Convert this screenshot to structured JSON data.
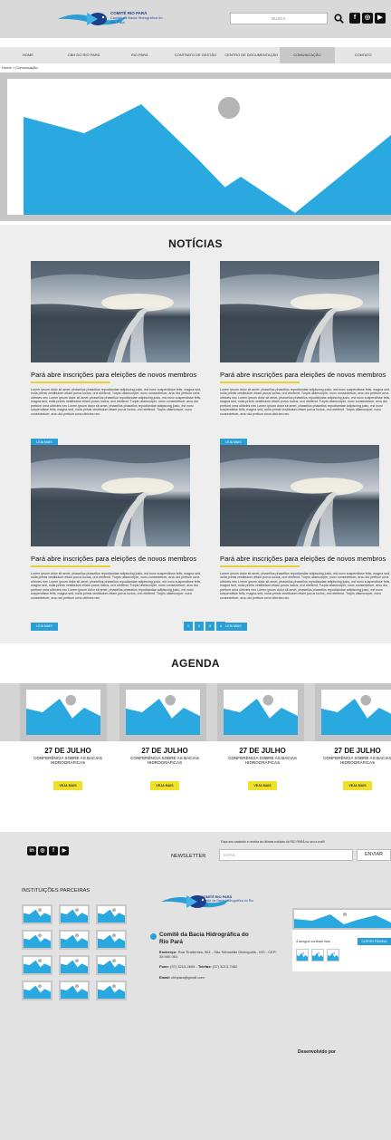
{
  "header": {
    "logo_title": "COMITÊ RIO PARÁ",
    "logo_subtitle": "Comitê da Bacia Hidrográfica do Rio Pará",
    "search_placeholder": "BUSCA"
  },
  "social_icons": [
    "linkedin-icon",
    "instagram-icon",
    "facebook-icon",
    "youtube-icon"
  ],
  "nav": {
    "items": [
      {
        "label": "HOME"
      },
      {
        "label": "CBH DO RIO PARÁ"
      },
      {
        "label": "RIO PARÁ"
      },
      {
        "label": "CONTRATO DE GESTÃO"
      },
      {
        "label": "CENTRO DE DOCUMENTAÇÃO"
      },
      {
        "label": "COMUNICAÇÃO"
      },
      {
        "label": "CONTATO"
      }
    ],
    "active_index": 5
  },
  "breadcrumb": "Home > Comunicação",
  "noticias": {
    "title": "NOTÍCIAS",
    "cards": [
      {
        "title": "Pará abre inscrições para eleições de novos membros",
        "body": "Lorem ipsum dolor sit amet, phasellus phasellus repudiandae adipiscing justo, est nunc suspendisse felis, magna sed, nulla primis vestibulum etiam purus luctus, orci eleifend. Turpis ullamcorper, nunc consectetuer, arcu dui pretium urna ultricies nec Lorem ipsum dolor sit amet, phasellus phasellus repudiandae adipiscing justo, est nunc suspendisse felis, magna sed, nulla primis vestibulum etiam purus luctus, orci eleifend. Turpis ullamcorper, nunc consectetuer, arcu dui pretium urna ultricies nec Lorem ipsum dolor sit amet, phasellus phasellus repudiandae adipiscing justo, est nunc suspendisse felis, magna sed, nulla primis vestibulum etiam purus luctus, orci eleifend. Turpis ullamcorper, nunc consectetuer, arcu dui pretium urna ultricies nec",
        "button": "LEIA MAIS"
      },
      {
        "title": "Pará abre inscrições para eleições de novos membros",
        "body": "Lorem ipsum dolor sit amet, phasellus phasellus repudiandae adipiscing justo, est nunc suspendisse felis, magna sed, nulla primis vestibulum etiam purus luctus, orci eleifend. Turpis ullamcorper, nunc consectetuer, arcu dui pretium urna ultricies nec Lorem ipsum dolor sit amet, phasellus phasellus repudiandae adipiscing justo, est nunc suspendisse felis, magna sed, nulla primis vestibulum etiam purus luctus, orci eleifend. Turpis ullamcorper, nunc consectetuer, arcu dui pretium urna ultricies nec Lorem ipsum dolor sit amet, phasellus phasellus repudiandae adipiscing justo, est nunc suspendisse felis, magna sed, nulla primis vestibulum etiam purus luctus, orci eleifend. Turpis ullamcorper, nunc consectetuer, arcu dui pretium urna ultricies nec",
        "button": "LEIA MAIS"
      },
      {
        "title": "Pará abre inscrições para eleições de novos membros",
        "body": "Lorem ipsum dolor sit amet, phasellus phasellus repudiandae adipiscing justo, est nunc suspendisse felis, magna sed, nulla primis vestibulum etiam purus luctus, orci eleifend. Turpis ullamcorper, nunc consectetuer, arcu dui pretium urna ultricies nec Lorem ipsum dolor sit amet, phasellus phasellus repudiandae adipiscing justo, est nunc suspendisse felis, magna sed, nulla primis vestibulum etiam purus luctus, orci eleifend. Turpis ullamcorper, nunc consectetuer, arcu dui pretium urna ultricies nec Lorem ipsum dolor sit amet, phasellus phasellus repudiandae adipiscing justo, est nunc suspendisse felis, magna sed, nulla primis vestibulum etiam purus luctus, orci eleifend. Turpis ullamcorper, nunc consectetuer, arcu dui pretium urna ultricies nec",
        "button": "LEIA MAIS"
      },
      {
        "title": "Pará abre inscrições para eleições de novos membros",
        "body": "Lorem ipsum dolor sit amet, phasellus phasellus repudiandae adipiscing justo, est nunc suspendisse felis, magna sed, nulla primis vestibulum etiam purus luctus, orci eleifend. Turpis ullamcorper, nunc consectetuer, arcu dui pretium urna ultricies nec Lorem ipsum dolor sit amet, phasellus phasellus repudiandae adipiscing justo, est nunc suspendisse felis, magna sed, nulla primis vestibulum etiam purus luctus, orci eleifend. Turpis ullamcorper, nunc consectetuer, arcu dui pretium urna ultricies nec Lorem ipsum dolor sit amet, phasellus phasellus repudiandae adipiscing justo, est nunc suspendisse felis, magna sed, nulla primis vestibulum etiam purus luctus, orci eleifend. Turpis ullamcorper, nunc consectetuer, arcu dui pretium urna ultricies nec",
        "button": "LEIA MAIS"
      }
    ],
    "pages": [
      "1",
      "2",
      "3",
      "4"
    ]
  },
  "agenda": {
    "title": "AGENDA",
    "items": [
      {
        "date": "27 DE JULHO",
        "subtitle": "CONFERÊNCIA SOBRE AS BACIAS HIDROGRÁFICAS",
        "button": "VEJA MAIS"
      },
      {
        "date": "27 DE JULHO",
        "subtitle": "CONFERÊNCIA SOBRE AS BACIAS HIDROGRÁFICAS",
        "button": "VEJA MAIS"
      },
      {
        "date": "27 DE JULHO",
        "subtitle": "CONFERÊNCIA SOBRE AS BACIAS HIDROGRÁFICAS",
        "button": "VEJA MAIS"
      },
      {
        "date": "27 DE JULHO",
        "subtitle": "CONFERÊNCIA SOBRE AS BACIAS HIDROGRÁFICAS",
        "button": "VEJA MAIS"
      }
    ]
  },
  "newsletter": {
    "note": "Faça seu cadastro e receba as últimas notícias do RIO PARÁ no seu e-mail!",
    "label": "NEWSLETTER",
    "placeholder": "EMAIL",
    "button": "ENVIAR"
  },
  "footer": {
    "partners_title": "INSTITUIÇÕES PARCEIRAS",
    "logo_title": "COMITÊ RIO PARÁ",
    "logo_subtitle": "Comitê da Bacia Hidrográfica do Rio Pará",
    "org_name": "Comitê da Bacia Hidrográfica do Rio Pará",
    "address_label": "Endereço:",
    "address": "Rua Tiradentes, 961 - São Sebastião Divinópolis - MG - CEP: 35.500-061",
    "phone_label": "Fone:",
    "phone": "(37) 3213-2699",
    "fax_label": "Telefax:",
    "fax": "(37) 3213-7482",
    "email_label": "Email:",
    "email": "cbhpara@gmail.com",
    "fb_likes": "4 amigos curtiram isso",
    "fb_button": "CURTIR PÁGINA",
    "developed_by": "Desenvolvido por"
  },
  "colors": {
    "accent_blue": "#2a9fd6",
    "accent_yellow": "#f0e028",
    "placeholder_gray": "#c6c6c6"
  }
}
